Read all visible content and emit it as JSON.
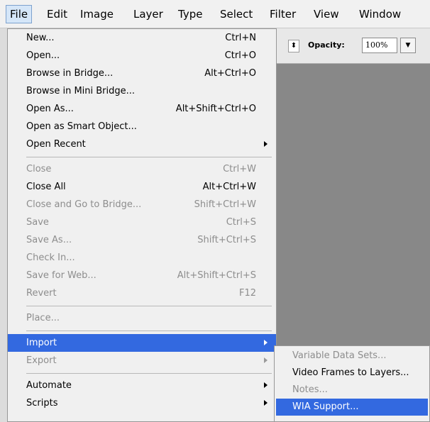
{
  "menubar": {
    "items": [
      {
        "label": "File",
        "active": true
      },
      {
        "label": "Edit"
      },
      {
        "label": "Image"
      },
      {
        "label": "Layer"
      },
      {
        "label": "Type"
      },
      {
        "label": "Select"
      },
      {
        "label": "Filter"
      },
      {
        "label": "View"
      },
      {
        "label": "Window"
      }
    ]
  },
  "options_bar": {
    "spinner_icon": "up-down-arrows",
    "opacity_label": "Opacity:",
    "opacity_value": "100%",
    "dropdown_icon": "triangle-down"
  },
  "file_menu": {
    "items": [
      {
        "label": "New...",
        "shortcut": "Ctrl+N"
      },
      {
        "label": "Open...",
        "shortcut": "Ctrl+O"
      },
      {
        "label": "Browse in Bridge...",
        "shortcut": "Alt+Ctrl+O"
      },
      {
        "label": "Browse in Mini Bridge..."
      },
      {
        "label": "Open As...",
        "shortcut": "Alt+Shift+Ctrl+O"
      },
      {
        "label": "Open as Smart Object..."
      },
      {
        "label": "Open Recent",
        "submenu": true
      },
      {
        "separator": true
      },
      {
        "label": "Close",
        "shortcut": "Ctrl+W",
        "disabled": true
      },
      {
        "label": "Close All",
        "shortcut": "Alt+Ctrl+W"
      },
      {
        "label": "Close and Go to Bridge...",
        "shortcut": "Shift+Ctrl+W",
        "disabled": true
      },
      {
        "label": "Save",
        "shortcut": "Ctrl+S",
        "disabled": true
      },
      {
        "label": "Save As...",
        "shortcut": "Shift+Ctrl+S",
        "disabled": true
      },
      {
        "label": "Check In...",
        "disabled": true
      },
      {
        "label": "Save for Web...",
        "shortcut": "Alt+Shift+Ctrl+S",
        "disabled": true
      },
      {
        "label": "Revert",
        "shortcut": "F12",
        "disabled": true
      },
      {
        "separator": true
      },
      {
        "label": "Place...",
        "disabled": true
      },
      {
        "separator": true
      },
      {
        "label": "Import",
        "submenu": true,
        "highlighted": true
      },
      {
        "label": "Export",
        "submenu": true,
        "disabled": true
      },
      {
        "separator": true
      },
      {
        "label": "Automate",
        "submenu": true
      },
      {
        "label": "Scripts",
        "submenu": true
      }
    ]
  },
  "import_submenu": {
    "items": [
      {
        "label": "Variable Data Sets...",
        "disabled": true
      },
      {
        "label": "Video Frames to Layers..."
      },
      {
        "label": "Notes...",
        "disabled": true
      },
      {
        "label": "WIA Support...",
        "highlighted": true
      }
    ]
  },
  "colors": {
    "highlight": "#3369e0",
    "menu_bg": "#f0f0f0",
    "disabled_text": "#8d8d8d",
    "canvas": "#888888"
  }
}
